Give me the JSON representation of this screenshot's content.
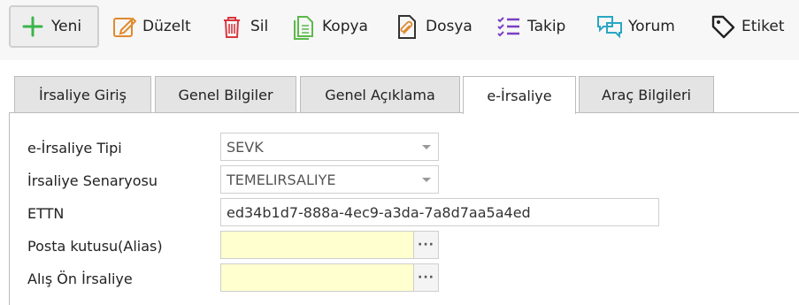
{
  "toolbar": {
    "items": [
      {
        "label": "Yeni",
        "icon": "plus-icon",
        "color": "#3ab54a"
      },
      {
        "label": "Düzelt",
        "icon": "edit-icon",
        "color": "#e08a2e"
      },
      {
        "label": "Sil",
        "icon": "trash-icon",
        "color": "#d9363e"
      },
      {
        "label": "Kopya",
        "icon": "copy-icon",
        "color": "#5cb94a"
      },
      {
        "label": "Dosya",
        "icon": "attachment-icon",
        "color": "#333333"
      },
      {
        "label": "Takip",
        "icon": "checklist-icon",
        "color": "#7b3fc4"
      },
      {
        "label": "Yorum",
        "icon": "comments-icon",
        "color": "#2aa6c4"
      },
      {
        "label": "Etiket",
        "icon": "tag-icon",
        "color": "#222222"
      }
    ]
  },
  "tabs": [
    {
      "label": "İrsaliye Giriş"
    },
    {
      "label": "Genel Bilgiler"
    },
    {
      "label": "Genel Açıklama"
    },
    {
      "label": "e-İrsaliye",
      "active": true
    },
    {
      "label": "Araç Bilgileri"
    }
  ],
  "form": {
    "irsaliye_tipi": {
      "label": "e-İrsaliye Tipi",
      "value": "SEVK"
    },
    "senaryo": {
      "label": "İrsaliye Senaryosu",
      "value": "TEMELIRSALIYE"
    },
    "ettn": {
      "label": "ETTN",
      "value": "ed34b1d7-888a-4ec9-a3da-7a8d7aa5a4ed"
    },
    "posta_kutusu": {
      "label": "Posta kutusu(Alias)",
      "value": "",
      "button": "···"
    },
    "alis_on_irsaliye": {
      "label": "Alış Ön İrsaliye",
      "value": "",
      "button": "···"
    }
  },
  "colors": {
    "input_highlight": "#ffffcf",
    "tab_inactive": "#e4e4e4",
    "toolbar_bg": "#f7f7f7"
  }
}
